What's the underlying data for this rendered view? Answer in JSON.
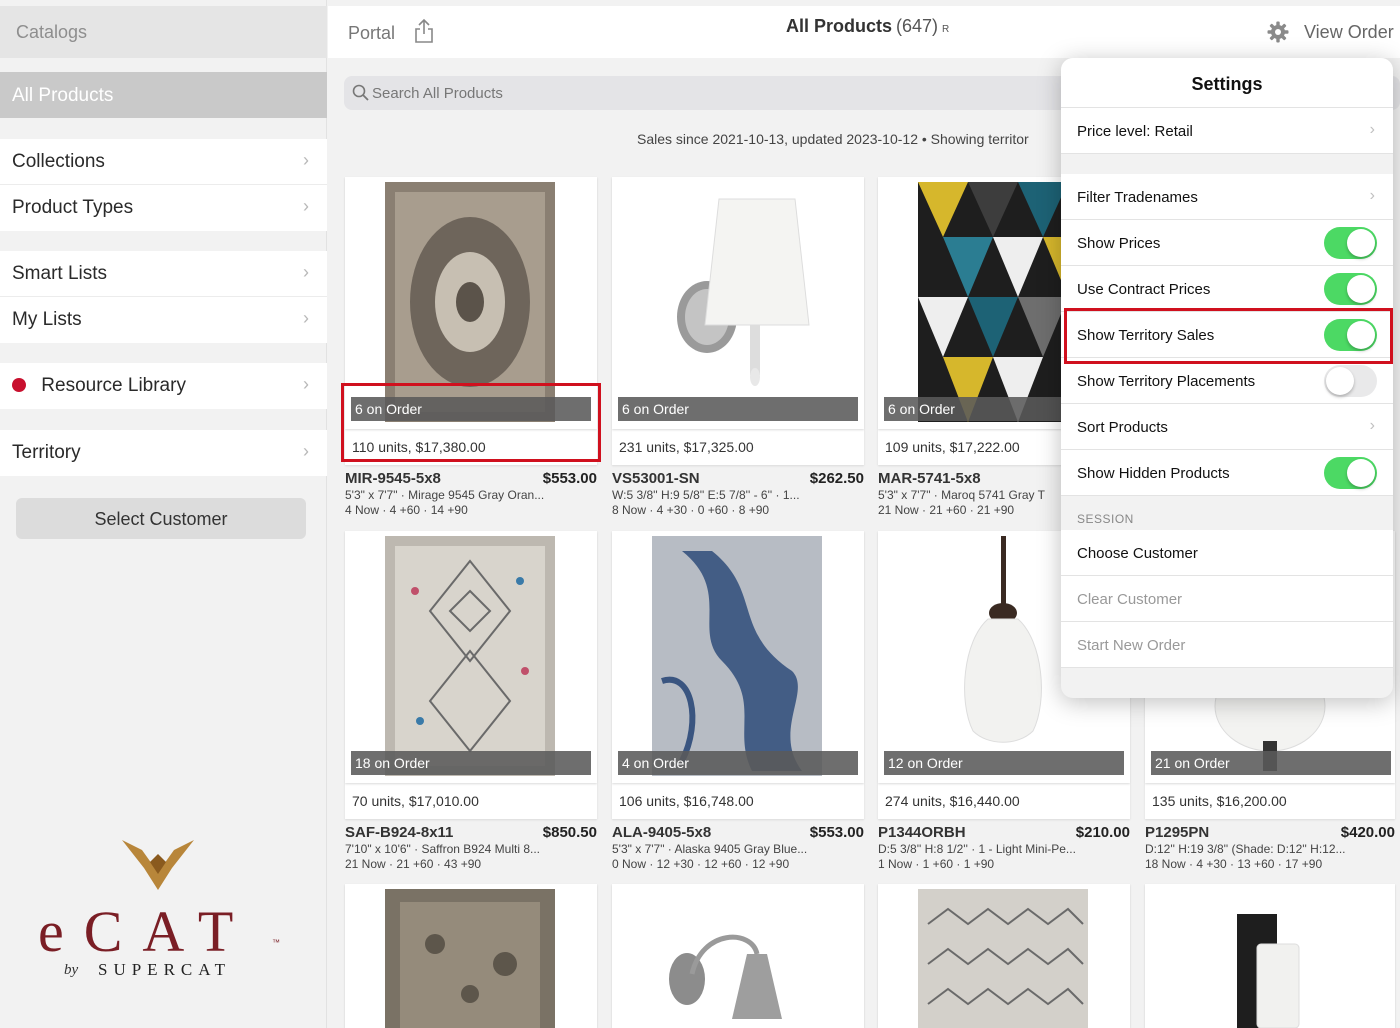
{
  "sidebar": {
    "header": "Catalogs",
    "selected": "All Products",
    "items": [
      {
        "label": "Collections"
      },
      {
        "label": "Product Types"
      },
      {
        "label": "Smart Lists"
      },
      {
        "label": "My Lists"
      },
      {
        "label": "Resource Library"
      },
      {
        "label": "Territory"
      }
    ],
    "select_customer": "Select Customer",
    "chevron": "›"
  },
  "logo": {
    "main": "eCAT",
    "tm": "™",
    "by": "by",
    "brand": "SUPERCAT",
    "accent": "#7a1e25"
  },
  "topbar": {
    "portal": "Portal",
    "title": "All Products",
    "count": "(647)",
    "badge": "R",
    "view_order": "View Order"
  },
  "search": {
    "placeholder": "Search All Products",
    "value": ""
  },
  "info_line": "Sales since 2021-10-13, updated 2023-10-12 • Showing territor",
  "products": [
    {
      "on_order": "6 on Order",
      "units": "110 units, $17,380.00",
      "sku": "MIR-9545-5x8",
      "price": "$553.00",
      "desc": "5'3\" x 7'7\" · Mirage 9545 Gray Oran...",
      "stock": "4 Now · 4 +60 · 14 +90"
    },
    {
      "on_order": "6 on Order",
      "units": "231 units, $17,325.00",
      "sku": "VS53001-SN",
      "price": "$262.50",
      "desc": "W:5 3/8'' H:9 5/8'' E:5 7/8'' - 6'' · 1...",
      "stock": "8 Now · 4 +30 · 0 +60 · 8 +90"
    },
    {
      "on_order": "6 on Order",
      "units": "109 units, $17,222.00",
      "sku": "MAR-5741-5x8",
      "price": "",
      "desc": "5'3\" x 7'7\" · Maroq 5741 Gray T",
      "stock": "21 Now · 21 +60 · 21 +90"
    },
    {
      "on_order": "18 on Order",
      "units": "70 units, $17,010.00",
      "sku": "SAF-B924-8x11",
      "price": "$850.50",
      "desc": "7'10\" x 10'6\" · Saffron B924 Multi 8...",
      "stock": "21 Now · 21 +60 · 43 +90"
    },
    {
      "on_order": "4 on Order",
      "units": "106 units, $16,748.00",
      "sku": "ALA-9405-5x8",
      "price": "$553.00",
      "desc": "5'3\" x 7'7\" · Alaska 9405 Gray Blue...",
      "stock": "0 Now · 12 +30 · 12 +60 · 12 +90"
    },
    {
      "on_order": "12 on Order",
      "units": "274 units, $16,440.00",
      "sku": "P1344ORBH",
      "price": "$210.00",
      "desc": "D:5 3/8'' H:8 1/2'' · 1 - Light Mini-Pe...",
      "stock": "1 Now · 1 +60 · 1 +90"
    },
    {
      "on_order": "21 on Order",
      "units": "135 units, $16,200.00",
      "sku": "P1295PN",
      "price": "$420.00",
      "desc": "D:12'' H:19 3/8'' (Shade: D:12'' H:12...",
      "stock": "18 Now · 4 +30 · 13 +60 · 17 +90"
    }
  ],
  "settings": {
    "title": "Settings",
    "rows": [
      {
        "label": "Price level: Retail"
      },
      {
        "label": "Filter Tradenames"
      },
      {
        "label": "Show Prices",
        "on": true
      },
      {
        "label": "Use Contract Prices",
        "on": true
      },
      {
        "label": "Show Territory Sales",
        "on": true
      },
      {
        "label": "Show Territory Placements",
        "on": false
      },
      {
        "label": "Sort Products"
      },
      {
        "label": "Show Hidden Products",
        "on": true
      }
    ],
    "session_label": "SESSION",
    "session_rows": [
      {
        "label": "Choose Customer"
      },
      {
        "label": "Clear Customer"
      },
      {
        "label": "Start New Order"
      }
    ]
  },
  "colors": {
    "toggle_on": "#4cd964",
    "highlight": "#d0101e",
    "resource_dot": "#c8102e"
  }
}
